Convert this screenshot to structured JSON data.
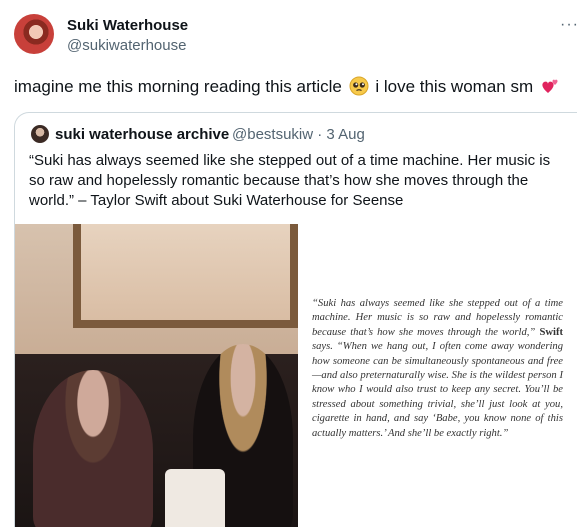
{
  "author": {
    "name": "Suki Waterhouse",
    "handle": "@sukiwaterhouse"
  },
  "more_icon": "more-horizontal-icon",
  "tweet": {
    "text_before": "imagine me this morning reading this article",
    "emoji1": "pleading-face-emoji",
    "text_after": "i love this woman sm",
    "emoji2": "two-hearts-emoji"
  },
  "quoted": {
    "name": "suki waterhouse archive",
    "handle_date": "@bestsukiw · 3 Aug",
    "text": "“Suki has always seemed like she stepped out of a time machine. Her music is so raw and hopelessly romantic because that’s how she moves through the world.” – Taylor Swift about Suki Waterhouse for Seense",
    "article_text_1": "“Suki has always seemed like she stepped out of a time machine. Her music is so raw and hopelessly romantic because that’s how she moves through the world,” ",
    "article_bold": "Swift",
    "article_text_2": " says. “When we hang out, I often come away wondering how someone can be simultaneously spontaneous and free—and also preternaturally wise. She is the wildest person I know who I would also trust to keep any secret. You’ll be stressed about something trivial, she’ll just look at you, cigarette in hand, and say ‘Babe, you know none of this actually matters.’ And she’ll be exactly right.”"
  },
  "colors": {
    "text": "#0f1419",
    "secondary": "#536471",
    "border": "#cfd9de"
  }
}
